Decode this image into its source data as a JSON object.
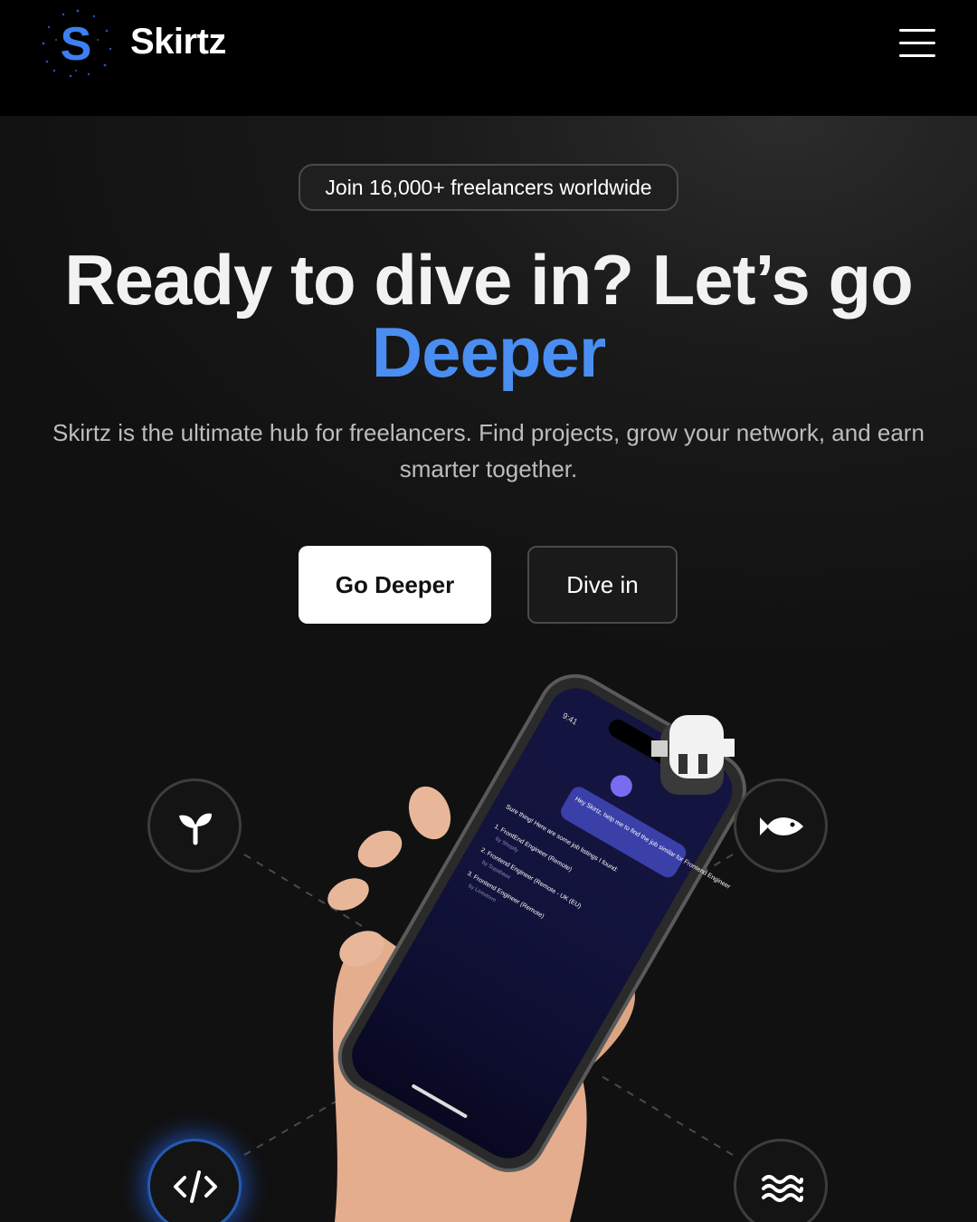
{
  "header": {
    "brand": "Skirtz",
    "logo_letter": "S",
    "menu_icon": "hamburger-menu-icon"
  },
  "hero": {
    "badge": "Join 16,000+ freelancers worldwide",
    "headline": "Ready to dive in? Let’s go",
    "headline_accent": "Deeper",
    "subtitle": "Skirtz is the ultimate hub for freelancers. Find projects, grow your network, and earn smarter together.",
    "primary_button": "Go Deeper",
    "secondary_button": "Dive in"
  },
  "features": [
    {
      "icon": "sprout-icon"
    },
    {
      "icon": "fish-icon"
    },
    {
      "icon": "code-icon"
    },
    {
      "icon": "waves-icon"
    }
  ],
  "phone": {
    "time": "9:41",
    "user_message": "Hey Skirtz, help me to find the job similar for Frontend Engineer",
    "reply": "Sure thing! Here are some job listings I found:",
    "jobs": [
      {
        "title": "1. FrontEnd Engineer (Remote)",
        "company": "by Shopify"
      },
      {
        "title": "2. Frontend Engineer (Remote - UK (EU)",
        "company": "by Supabase"
      },
      {
        "title": "3. Frontend Engineer (Remote)",
        "company": "by Livestorm"
      }
    ]
  },
  "colors": {
    "accent": "#4a8ef2",
    "background": "#161616",
    "header": "#000000",
    "glow": "#286eff"
  }
}
